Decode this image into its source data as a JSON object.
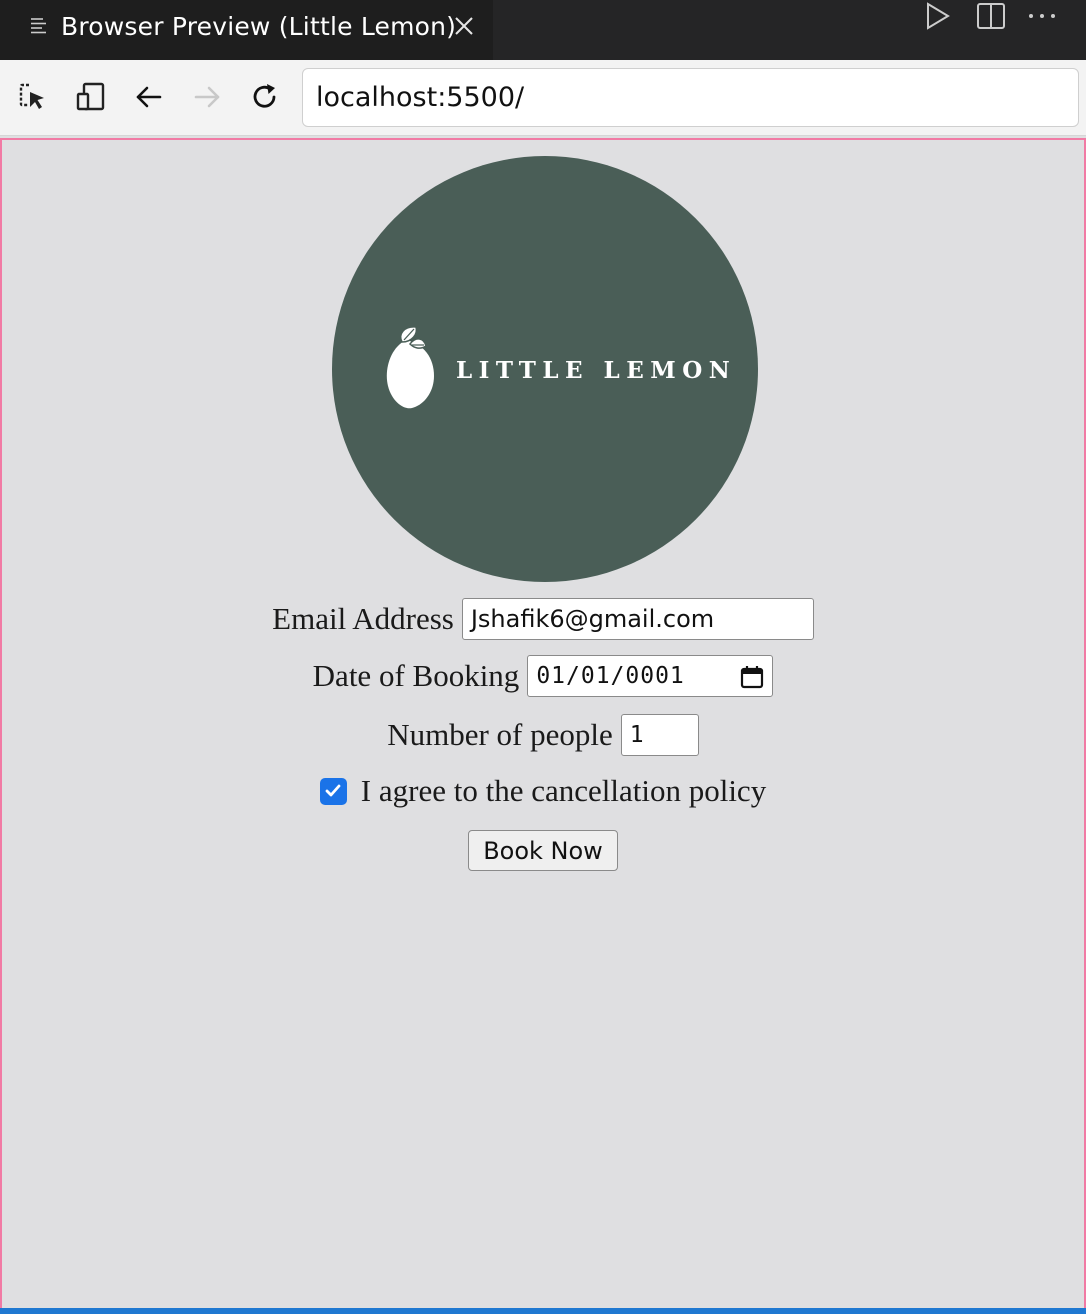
{
  "tab": {
    "title": "Browser Preview (Little Lemon)"
  },
  "toolbar": {
    "url": "localhost:5500/"
  },
  "logo": {
    "text": "LITTLE LEMON"
  },
  "form": {
    "email_label": "Email Address",
    "email_value": "Jshafik6@gmail.com",
    "date_label": "Date of Booking",
    "date_value": "01/01/0001",
    "people_label": "Number of people",
    "people_value": "1",
    "policy_label": "I agree to the cancellation policy",
    "policy_checked": true,
    "submit_label": "Book Now"
  },
  "colors": {
    "accent": "#1a73e8",
    "logo_bg": "#4a5e57",
    "viewport_border": "#f17aa4",
    "page_bg": "#dfdfe1"
  }
}
